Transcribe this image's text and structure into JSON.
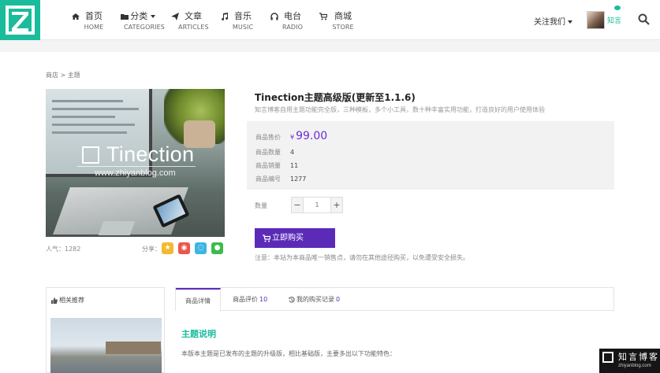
{
  "nav": {
    "items": [
      {
        "cn": "首页",
        "en": "HOME"
      },
      {
        "cn": "分类",
        "en": "CATEGORIES"
      },
      {
        "cn": "文章",
        "en": "ARTICLES"
      },
      {
        "cn": "音乐",
        "en": "MUSIC"
      },
      {
        "cn": "电台",
        "en": "RADIO"
      },
      {
        "cn": "商城",
        "en": "STORE"
      }
    ],
    "follow": "关注我们",
    "username": "知言"
  },
  "breadcrumb": "商店 > 主题",
  "product": {
    "image_brand": "Tinection",
    "image_url": "www.zhiyanblog.com",
    "title": "Tinection主题高级版(更新至1.1.6)",
    "subtitle": "知言博客自用主题功能完全版，三种模板，多个小工具，数十种丰富实用功能，打造良好的用户使用体验",
    "price_label": "商品售价",
    "price_symbol": "¥",
    "price": "99.00",
    "stock_label": "商品数量",
    "stock": "4",
    "sales_label": "商品销量",
    "sales": "11",
    "id_label": "商品编号",
    "id": "1277",
    "qty_label": "数量",
    "qty_minus": "−",
    "qty_value": "1",
    "qty_plus": "+",
    "buy_label": "立即购买",
    "notice": "注意：本站为本商品唯一销售点，请勿在其他途径购买，以免遭受安全损失。",
    "popularity": "人气：1282",
    "share_label": "分享："
  },
  "related": {
    "title": "相关推荐"
  },
  "tabs": [
    {
      "label": "商品详情",
      "count": ""
    },
    {
      "label": "商品评价",
      "count": "10"
    },
    {
      "label": "我的购买记录",
      "count": "0"
    }
  ],
  "detail": {
    "section_title": "主题说明",
    "section_text": "本版本主题是已发布的主题的升级版，相比基础版，主要多出以下功能特色："
  },
  "watermark": {
    "text": "知言博客",
    "url": "zhiyanblog.com"
  },
  "colors": {
    "accent": "#1abc9c",
    "purple": "#5b2bb8",
    "price": "#6c2bd9"
  }
}
